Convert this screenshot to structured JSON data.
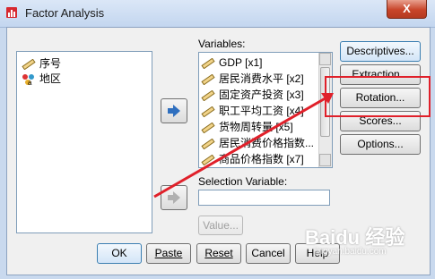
{
  "window": {
    "title": "Factor Analysis",
    "close_label": "X"
  },
  "source_list": {
    "items": [
      {
        "label": "序号",
        "icon": "ruler-icon"
      },
      {
        "label": "地区",
        "icon": "nominal-icon"
      }
    ]
  },
  "variables": {
    "label": "Variables:",
    "items": [
      "GDP [x1]",
      "居民消费水平 [x2]",
      "固定资产投资 [x3]",
      "职工平均工资 [x4]",
      "货物周转量 [x5]",
      "居民消费价格指数...",
      "商品价格指数 [x7]"
    ]
  },
  "selection_variable": {
    "label": "Selection Variable:",
    "value": ""
  },
  "value_button": "Value...",
  "side_buttons": {
    "descriptives": "Descriptives...",
    "extraction": "Extraction...",
    "rotation": "Rotation...",
    "scores": "Scores...",
    "options": "Options..."
  },
  "bottom_buttons": {
    "ok": "OK",
    "paste": "Paste",
    "reset": "Reset",
    "cancel": "Cancel",
    "help": "Help"
  },
  "watermark": {
    "main": "Baidu 经验",
    "url": "jingyan.baidu.com"
  },
  "colors": {
    "annotation": "#e0202a",
    "window_bg": "#f0f0f0",
    "title_bg": "#c3d6ef"
  }
}
